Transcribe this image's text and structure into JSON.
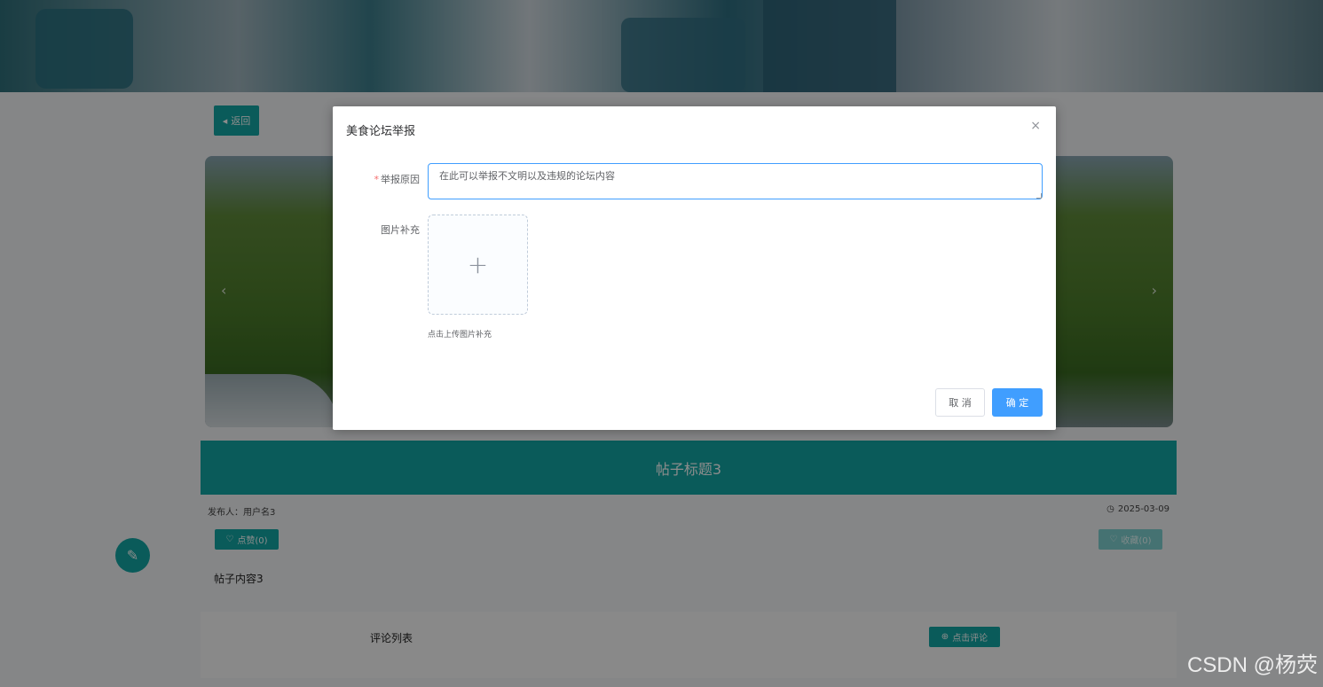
{
  "page": {
    "back_label": "返回",
    "post_title": "帖子标题3",
    "poster": "发布人：用户名3",
    "date": "2025-03-09",
    "like_label": "点赞(0)",
    "collect_label": "收藏(0)",
    "content": "帖子内容3",
    "comment_list_label": "评论列表",
    "comment_button_label": "点击评论"
  },
  "dialog": {
    "title": "美食论坛举报",
    "close_glyph": "×",
    "reason_label": "举报原因",
    "reason_required_mark": "*",
    "reason_value": "在此可以举报不文明以及违规的论坛内容",
    "image_label": "图片补充",
    "upload_plus": "+",
    "upload_tip": "点击上传图片补充",
    "cancel_label": "取 消",
    "confirm_label": "确 定"
  },
  "watermark": "CSDN @杨荧",
  "colors": {
    "primary_teal": "#13a7a4",
    "dialog_primary": "#409eff",
    "overlay": "rgba(0,0,0,0.45)"
  }
}
